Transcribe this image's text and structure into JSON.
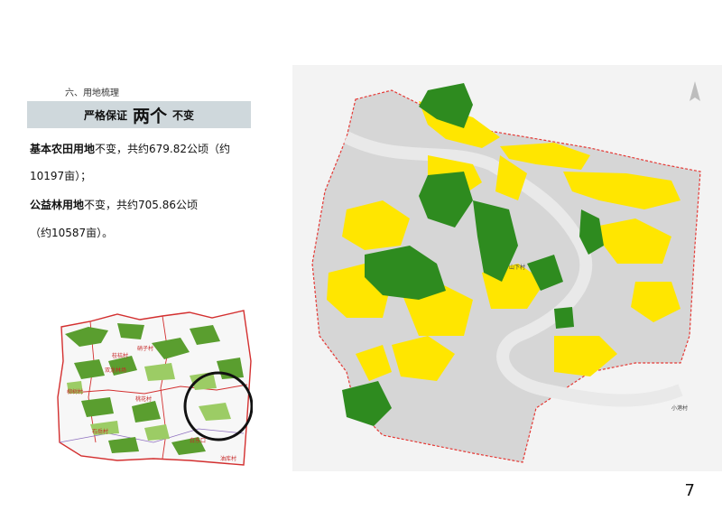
{
  "section_label": "六、用地梳理",
  "banner": {
    "part1": "严格保证",
    "part2": "两个",
    "part3": "不变"
  },
  "para1": {
    "bold": "基本农田用地",
    "text": "不变，共约679.82公顷（约",
    "line2": "10197亩）；"
  },
  "para2": {
    "bold": "公益林用地",
    "text": "不变，共约705.86公顷",
    "line2": "（约10587亩）。"
  },
  "inset_map": {
    "villages": [
      "硝子村",
      "桂桔村",
      "柳树村",
      "桃花村",
      "双龙林场",
      "石岳村",
      "白东口",
      "油库村"
    ],
    "colors": {
      "forest": "#5a9e2f",
      "forest_light": "#9ccc65",
      "boundary": "#d32f2f",
      "circle": "#111111"
    }
  },
  "main_map": {
    "labels": [
      "山下村",
      "小港村"
    ],
    "colors": {
      "forest": "#2e8b1f",
      "farmland": "#ffe600",
      "base": "#d6d6d6",
      "boundary": "#e53935"
    }
  },
  "page_number": "7"
}
